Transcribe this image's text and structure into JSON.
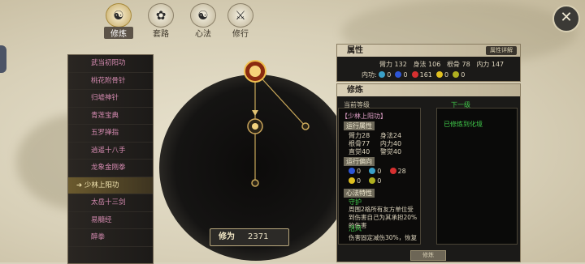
{
  "tabs": [
    {
      "label": "修炼",
      "icon": "☯",
      "active": true
    },
    {
      "label": "套路",
      "icon": "✿",
      "active": false
    },
    {
      "label": "心法",
      "icon": "☯",
      "active": false
    },
    {
      "label": "修行",
      "icon": "⚔",
      "active": false
    }
  ],
  "skills": [
    "武当初阳功",
    "桃花附骨针",
    "归墟神针",
    "青莲宝典",
    "五罗掸指",
    "逍遥十八手",
    "龙象金刚拳",
    "少林上阳功",
    "太岳十三剑",
    "易髓经",
    "醉拳"
  ],
  "selected_skill_index": 7,
  "score": {
    "label": "修为",
    "value": "2371"
  },
  "attributes": {
    "title": "属性",
    "detail_button": "属性详解",
    "stats": [
      {
        "name": "臂力",
        "value": "132"
      },
      {
        "name": "身法",
        "value": "106"
      },
      {
        "name": "根骨",
        "value": "78"
      },
      {
        "name": "内力",
        "value": "147"
      }
    ],
    "neigong_label": "内功:",
    "neigong": [
      {
        "color": "#3aa0c8",
        "value": "0"
      },
      {
        "color": "#2d56d6",
        "value": "0"
      },
      {
        "color": "#d63030",
        "value": "161"
      },
      {
        "color": "#e0c020",
        "value": "0"
      },
      {
        "color": "#b0b020",
        "value": "0"
      }
    ]
  },
  "cultivation": {
    "title": "修炼",
    "current_label": "当前等级",
    "next_label": "下一级",
    "skill_name": "【少林上阳功】",
    "section_attr": "运行属性",
    "stats": [
      {
        "name": "臂力",
        "value": "28"
      },
      {
        "name": "身法",
        "value": "24"
      },
      {
        "name": "根骨",
        "value": "77"
      },
      {
        "name": "内力",
        "value": "40"
      },
      {
        "name": "直觉",
        "value": "40"
      },
      {
        "name": "警觉",
        "value": "40"
      }
    ],
    "section_tendency": "运行偏向",
    "tendency": [
      {
        "color": "#2d56d6",
        "value": "0"
      },
      {
        "color": "#3aa0c8",
        "value": "0"
      },
      {
        "color": "#d63030",
        "value": "28"
      },
      {
        "color": "#e0c020",
        "value": "0"
      },
      {
        "color": "#b0b020",
        "value": "0"
      }
    ],
    "section_special": "心法特性",
    "trait1_name": "守护",
    "trait1_desc": "周围2格所有友方单位受到伤害自己为其承担20%的伤害",
    "trait2_name": "活风",
    "trait2_desc": "伤害固定减伤30%，恢复",
    "next_text": "已修炼到化境",
    "bottom_button": "修炼"
  }
}
